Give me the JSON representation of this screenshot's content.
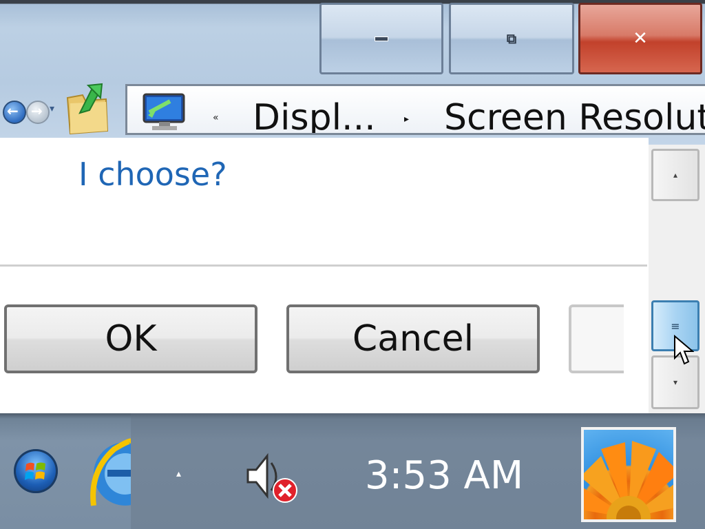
{
  "window": {
    "minimize_glyph": "–",
    "restore_glyph": "⧉",
    "close_glyph": "✕"
  },
  "nav": {
    "chevron": "«",
    "breadcrumb": [
      "Displ...",
      "Screen Resolut"
    ],
    "separator": "▸"
  },
  "content": {
    "help_link": "I choose?",
    "buttons": {
      "ok": "OK",
      "cancel": "Cancel",
      "apply": ""
    }
  },
  "scrollbar": {
    "up_glyph": "▴",
    "thumb_glyph": "≡",
    "down_glyph": "▾"
  },
  "taskbar": {
    "tray_arrow": "▴",
    "clock": "3:53 AM"
  },
  "colors": {
    "link": "#1f66b5",
    "close_red": "#c2412b",
    "taskbar": "#7a8ea3"
  }
}
